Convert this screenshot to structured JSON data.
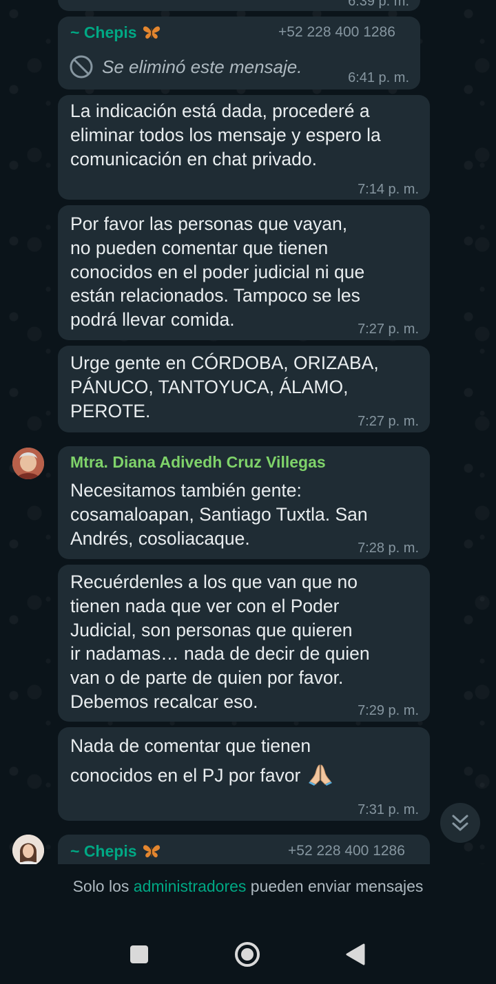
{
  "top_partial": {
    "time": "6:39 p. m."
  },
  "messages": [
    {
      "sender": "~ Chepis",
      "phone": "+52 228 400 1286",
      "deleted_text": "Se eliminó este mensaje.",
      "time": "6:41 p. m."
    },
    {
      "lines": [
        "La indicación está dada, procederé a",
        "eliminar todos los mensaje y espero la",
        "comunicación en chat privado."
      ],
      "time": "7:14 p. m."
    },
    {
      "lines": [
        "Por favor las personas que vayan,",
        "no pueden comentar que tienen",
        "conocidos en el poder judicial ni que",
        "están relacionados. Tampoco se les",
        "podrá llevar comida."
      ],
      "time": "7:27 p. m."
    },
    {
      "lines": [
        "Urge gente en CÓRDOBA, ORIZABA,",
        "PÁNUCO, TANTOYUCA, ÁLAMO,",
        "PEROTE."
      ],
      "time": "7:27 p. m."
    },
    {
      "sender": "Mtra. Diana Adivedh Cruz Villegas",
      "lines": [
        "Necesitamos también gente:",
        "cosamaloapan, Santiago Tuxtla. San",
        "Andrés, cosoliacaque."
      ],
      "time": "7:28 p. m."
    },
    {
      "lines": [
        "Recuérdenles a los que van que no",
        "tienen nada que ver con el Poder",
        "Judicial, son personas que quieren",
        "ir nadamas… nada de decir de quien",
        "van o de parte de quien por favor.",
        "Debemos recalcar eso."
      ],
      "time": "7:29 p. m."
    },
    {
      "lines": [
        "Nada de comentar que tienen",
        "conocidos en el PJ por favor"
      ],
      "emoji": "🙏",
      "time": "7:31 p. m."
    },
    {
      "sender": "~ Chepis",
      "phone": "+52 228 400 1286"
    }
  ],
  "footer": {
    "prefix": "Solo los ",
    "link": "administradores",
    "suffix": " pueden enviar mensajes"
  },
  "colors": {
    "background": "#0b141a",
    "bubble": "#1f2c34",
    "sender_chepis": "#00a884",
    "sender_diana": "#7fd36a",
    "accent": "#00a884",
    "meta": "#8696a0"
  },
  "icons": {
    "deleted": "prohibited-icon",
    "butterfly": "butterfly-icon",
    "scroll": "double-chevron-down-icon",
    "nav_recents": "square-icon",
    "nav_home": "circle-icon",
    "nav_back": "triangle-back-icon"
  }
}
